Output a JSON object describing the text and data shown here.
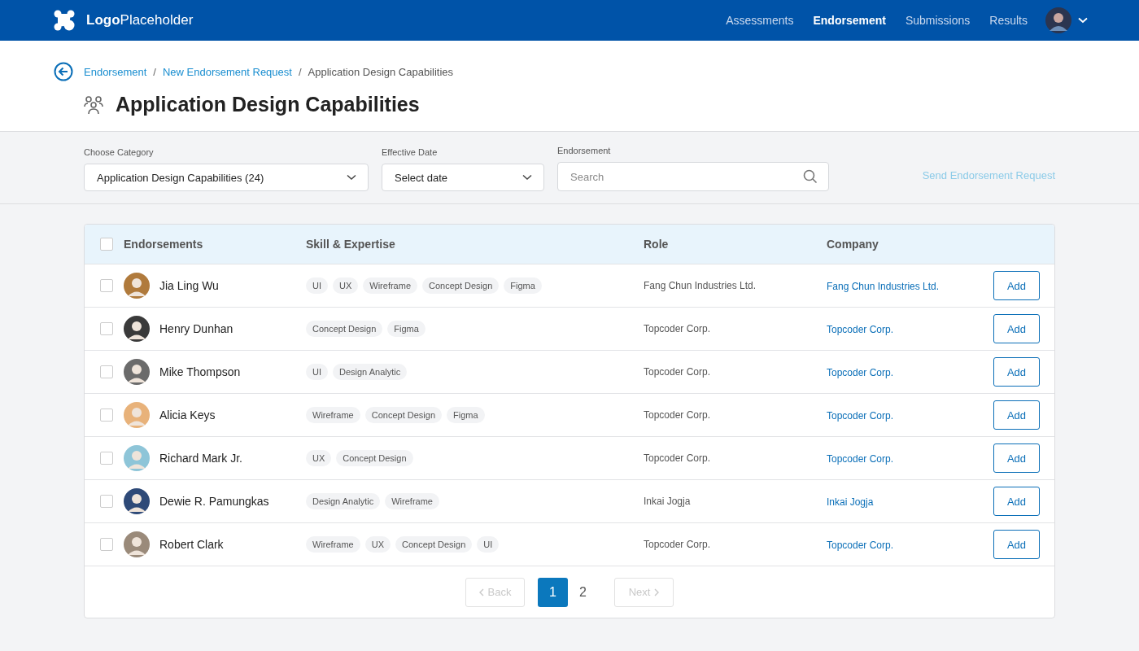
{
  "logo": {
    "bold": "Logo",
    "light": "Placeholder"
  },
  "nav": [
    {
      "label": "Assessments",
      "selected": false
    },
    {
      "label": "Endorsement",
      "selected": true
    },
    {
      "label": "Submissions",
      "selected": false
    },
    {
      "label": "Results",
      "selected": false
    }
  ],
  "breadcrumb": [
    {
      "label": "Endorsement",
      "link": true
    },
    {
      "separator": "/",
      "label": "New Endorsement Request",
      "link": true
    },
    {
      "separator": "/",
      "label": "Application Design Capabilities",
      "link": false
    }
  ],
  "title": "Application Design Capabilities",
  "filters": {
    "category": {
      "label": "Choose Category",
      "value": "Application Design Capabilities (24)"
    },
    "date": {
      "label": "Effective Date",
      "value": "Select date"
    },
    "search": {
      "label": "Endorsement",
      "placeholder": "Search"
    },
    "send_button": {
      "label": "Send Endorsement Request",
      "disabled": true
    }
  },
  "table": {
    "select_all_checked": false,
    "columns": [
      "Endorsements",
      "Skill & Expertise",
      "Role",
      "Company"
    ],
    "rows": [
      {
        "checked": false,
        "name": "Jia Ling Wu",
        "color": "#b07a3c",
        "skills": [
          "UI",
          "UX",
          "Wireframe",
          "Concept Design",
          "Figma"
        ],
        "role": "Fang Chun Industries Ltd.",
        "company": "Fang Chun Industries Ltd.",
        "action": "Add"
      },
      {
        "checked": false,
        "name": "Henry Dunhan",
        "color": "#3a3a3a",
        "skills": [
          "Concept Design",
          "Figma"
        ],
        "role": "Topcoder Corp.",
        "company": "Topcoder Corp.",
        "action": "Add"
      },
      {
        "checked": false,
        "name": "Mike Thompson",
        "color": "#6b6b6b",
        "skills": [
          "UI",
          "Design Analytic"
        ],
        "role": "Topcoder Corp.",
        "company": "Topcoder Corp.",
        "action": "Add"
      },
      {
        "checked": false,
        "name": "Alicia Keys",
        "color": "#e8b27a",
        "skills": [
          "Wireframe",
          "Concept Design",
          "Figma"
        ],
        "role": "Topcoder Corp.",
        "company": "Topcoder Corp.",
        "action": "Add"
      },
      {
        "checked": false,
        "name": "Richard Mark Jr.",
        "color": "#8ec5d8",
        "skills": [
          "UX",
          "Concept Design"
        ],
        "role": "Topcoder Corp.",
        "company": "Topcoder Corp.",
        "action": "Add"
      },
      {
        "checked": false,
        "name": "Dewie R. Pamungkas",
        "color": "#2e4a78",
        "skills": [
          "Design Analytic",
          "Wireframe"
        ],
        "role": "Inkai Jogja",
        "company": "Inkai Jogja",
        "action": "Add"
      },
      {
        "checked": false,
        "name": "Robert Clark",
        "color": "#9a8a7a",
        "skills": [
          "Wireframe",
          "UX",
          "Concept Design",
          "UI"
        ],
        "role": "Topcoder Corp.",
        "company": "Topcoder Corp.",
        "action": "Add"
      }
    ]
  },
  "pagination": {
    "back": {
      "label": "Back",
      "disabled": true
    },
    "pages": [
      {
        "label": "1",
        "selected": true
      },
      {
        "label": "2",
        "selected": false
      }
    ],
    "next": {
      "label": "Next",
      "disabled": true
    }
  }
}
